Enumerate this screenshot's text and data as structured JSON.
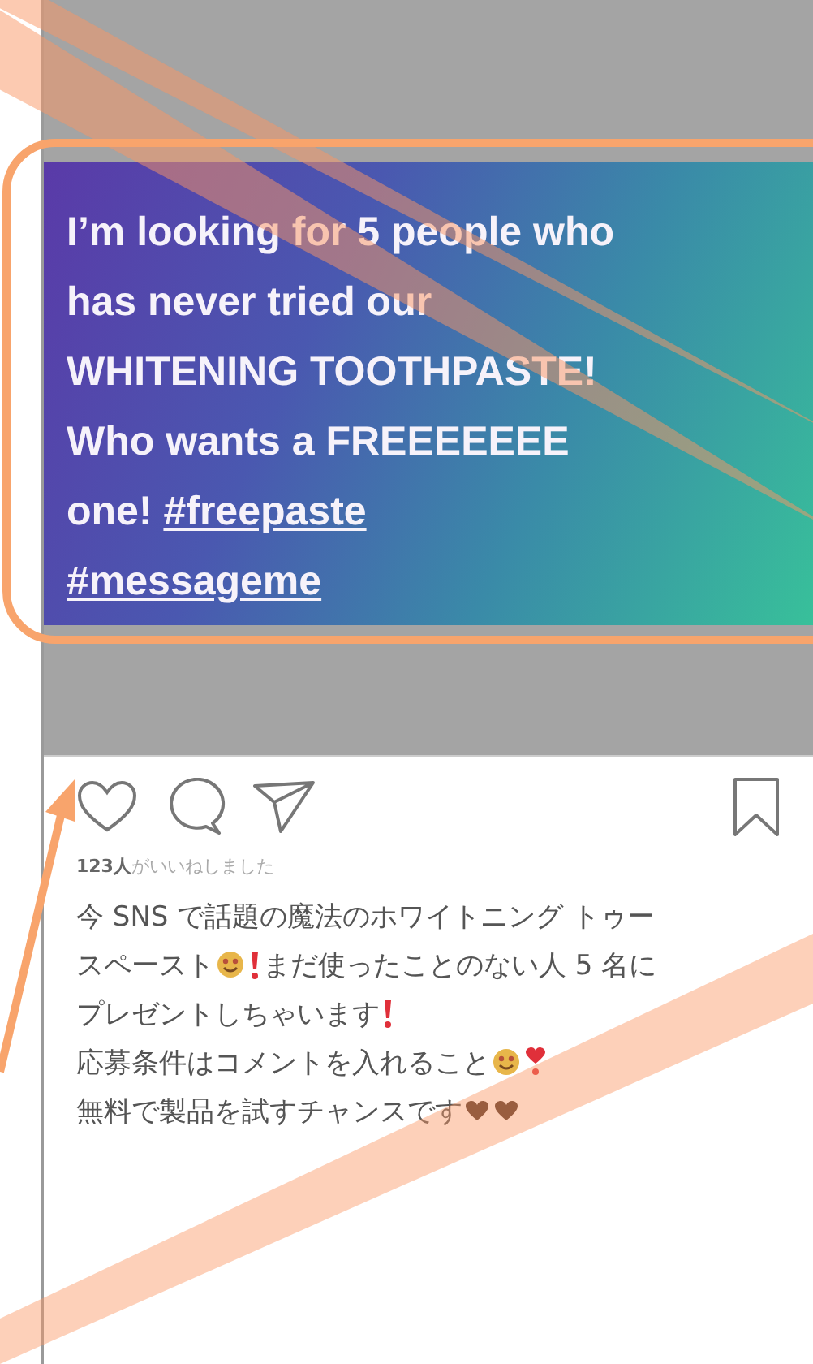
{
  "post": {
    "image_text": [
      [
        {
          "kind": "text",
          "text": "I’m looking for 5 people who"
        }
      ],
      [
        {
          "kind": "text",
          "text": "has never tried our"
        }
      ],
      [
        {
          "kind": "text",
          "text": "WHITENING TOOTHPASTE!"
        }
      ],
      [
        {
          "kind": "text",
          "text": "Who wants a FREEEEEEE"
        }
      ],
      [
        {
          "kind": "text",
          "text": "one! "
        },
        {
          "kind": "hashtag",
          "text": "#freepaste"
        }
      ],
      [
        {
          "kind": "hashtag",
          "text": "#messageme"
        }
      ]
    ],
    "likes": "**123人**がいいねしました",
    "caption": [
      [
        {
          "kind": "text",
          "text": "今 SNS で話題の魔法のホワイトニング トゥー"
        }
      ],
      [
        {
          "kind": "text",
          "text": "スペースト"
        },
        {
          "kind": "face"
        },
        {
          "kind": "alert"
        },
        {
          "kind": "text",
          "text": " まだ使ったことのない人 5 名に"
        }
      ],
      [
        {
          "kind": "text",
          "text": "プレゼントしちゃいます"
        },
        {
          "kind": "alert"
        }
      ],
      [
        {
          "kind": "text",
          "text": "応募条件はコメントを入れること"
        },
        {
          "kind": "face"
        },
        {
          "kind": "heart-alert"
        }
      ],
      [
        {
          "kind": "text",
          "text": "無料で製品を試すチャンスです"
        },
        {
          "kind": "heart"
        },
        {
          "kind": "heart"
        }
      ]
    ]
  }
}
